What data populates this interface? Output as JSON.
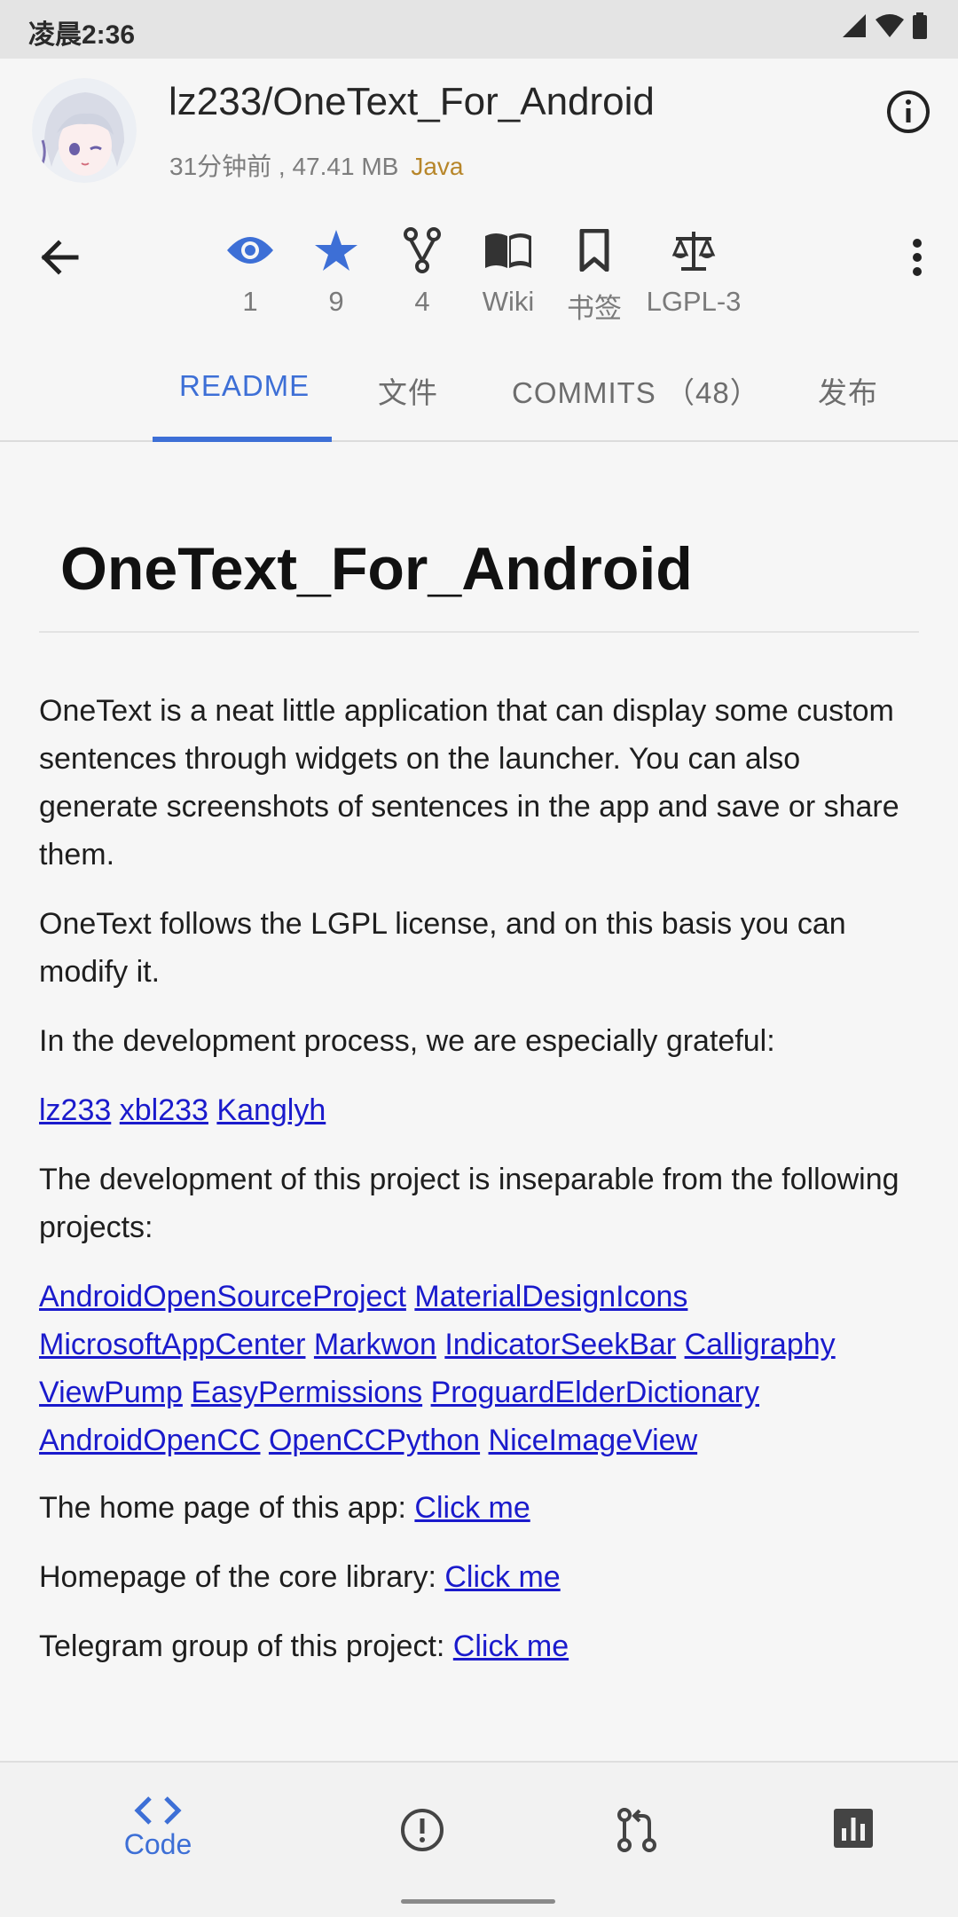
{
  "status_bar": {
    "time": "凌晨2:36"
  },
  "repo": {
    "name": "lz233/OneText_For_Android",
    "meta": "31分钟前 , 47.41 MB",
    "language": "Java"
  },
  "stats": [
    {
      "icon": "eye-icon",
      "label": "1"
    },
    {
      "icon": "star-icon",
      "label": "9"
    },
    {
      "icon": "fork-icon",
      "label": "4"
    },
    {
      "icon": "book-icon",
      "label": "Wiki"
    },
    {
      "icon": "bookmark-icon",
      "label": "书签"
    },
    {
      "icon": "scale-icon",
      "label": "LGPL-3"
    }
  ],
  "tabs": [
    {
      "label": "README",
      "active": true
    },
    {
      "label": "文件"
    },
    {
      "label": "COMMITS （48）"
    },
    {
      "label": "发布"
    }
  ],
  "readme": {
    "title": "OneText_For_Android",
    "p1": "OneText is a neat little application that can display some custom sentences through widgets on the launcher. You can also generate screenshots of sentences in the app and save or share them.",
    "p2": "OneText follows the LGPL license, and on this basis you can modify it.",
    "p3": "In the development process, we are especially grateful:",
    "contributors": [
      "lz233",
      "xbl233",
      "Kanglyh"
    ],
    "p4": "The development of this project is inseparable from the following projects:",
    "projects": [
      "AndroidOpenSourceProject",
      "MaterialDesignIcons",
      "MicrosoftAppCenter",
      "Markwon",
      "IndicatorSeekBar",
      "Calligraphy",
      "ViewPump",
      "EasyPermissions",
      "ProguardElderDictionary",
      "AndroidOpenCC",
      "OpenCCPython",
      "NiceImageView"
    ],
    "home_label": "The home page of this app:",
    "core_label": "Homepage of the core library:",
    "telegram_label": "Telegram group of this project:",
    "click_me": "Click me"
  },
  "bottom_nav": {
    "code_label": "Code",
    "accent": "#3d6fd6"
  }
}
